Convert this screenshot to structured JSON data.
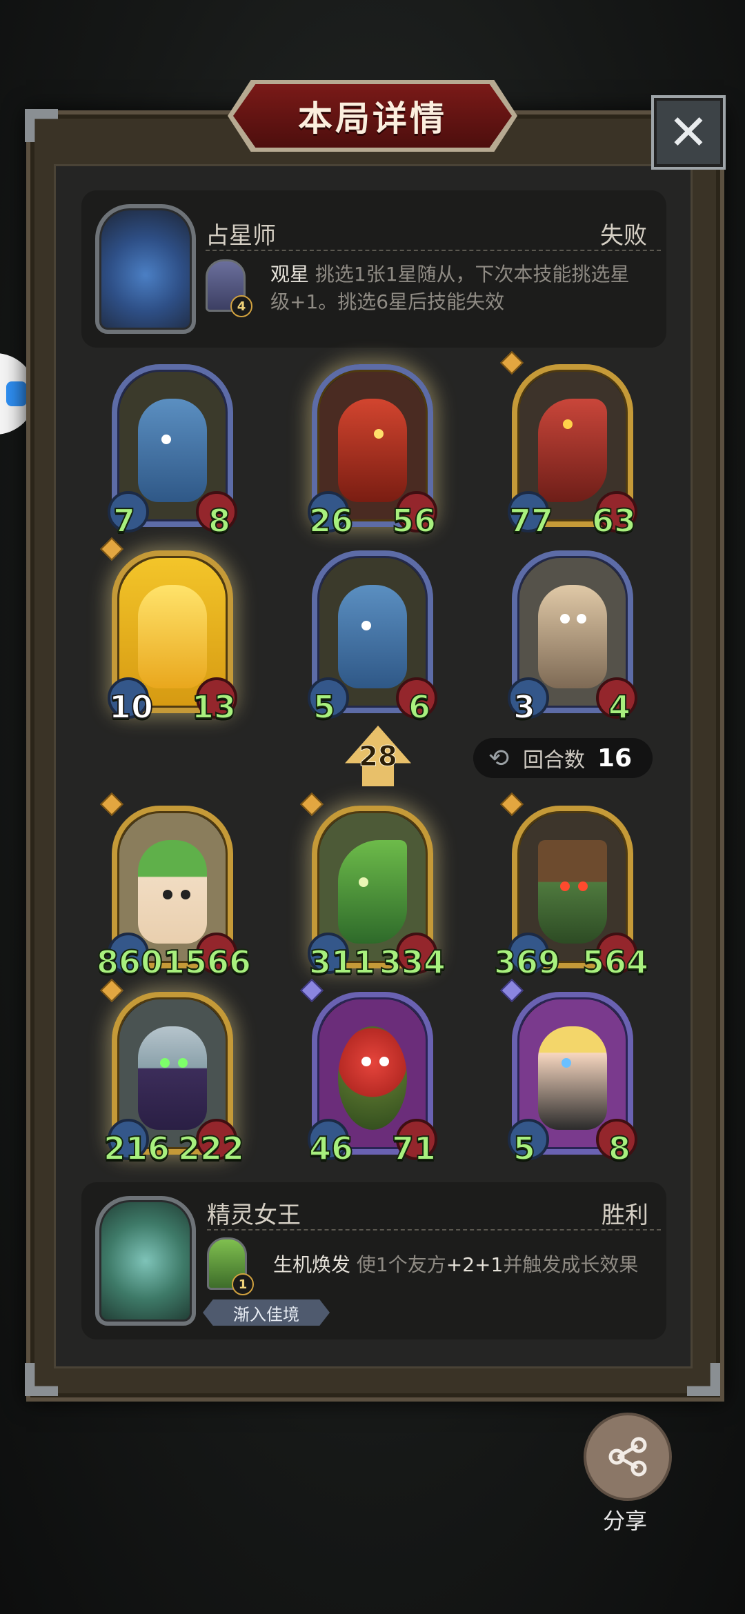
{
  "title": "本局详情",
  "close_icon": "close-icon",
  "opponent": {
    "name": "占星师",
    "result": "失败",
    "skill_level": "4",
    "skill_name": "观星",
    "skill_desc_line1": "挑选1张1星随从，下次本技能挑选星",
    "skill_desc_line2": "级+1。挑选6星后技能失效"
  },
  "opponent_units": [
    {
      "atk": "7",
      "hp": "8",
      "frame": "blue",
      "art": "blue-dragon"
    },
    {
      "atk": "26",
      "hp": "56",
      "frame": "blue",
      "art": "red-dragon"
    },
    {
      "atk": "77",
      "hp": "63",
      "frame": "gold",
      "art": "red-serpent"
    },
    {
      "atk": "10",
      "hp": "13",
      "frame": "gold",
      "art": "golden-dragon"
    },
    {
      "atk": "5",
      "hp": "6",
      "frame": "blue",
      "art": "blue-dragon"
    },
    {
      "atk": "3",
      "hp": "4",
      "frame": "blue",
      "art": "scholar"
    }
  ],
  "tier": "28",
  "rounds": {
    "label": "回合数",
    "value": "16"
  },
  "player_units": [
    {
      "atk": "860",
      "hp": "1566",
      "frame": "gold",
      "art": "leaf-girl"
    },
    {
      "atk": "311",
      "hp": "334",
      "frame": "gold",
      "art": "green-dryad"
    },
    {
      "atk": "369",
      "hp": "564",
      "frame": "gold",
      "art": "goblin-wizard"
    },
    {
      "atk": "216",
      "hp": "222",
      "frame": "gold",
      "art": "dark-elf"
    },
    {
      "atk": "46",
      "hp": "71",
      "frame": "purple",
      "art": "red-imp"
    },
    {
      "atk": "5",
      "hp": "8",
      "frame": "purple",
      "art": "fairy"
    }
  ],
  "player": {
    "name": "精灵女王",
    "result": "胜利",
    "skill_level": "1",
    "skill_name": "生机焕发",
    "skill_desc_prefix": "使1个友方",
    "skill_desc_bonus": "+2+1",
    "skill_desc_suffix": "并触发成长效果",
    "badge": "渐入佳境"
  },
  "share_label": "分享",
  "colors": {
    "banner": "#7a1a18",
    "atk_green": "#a8f07e",
    "gold_frame": "#c59a38",
    "blue_frame": "#5d6ca7",
    "purple_frame": "#6a62b2"
  }
}
